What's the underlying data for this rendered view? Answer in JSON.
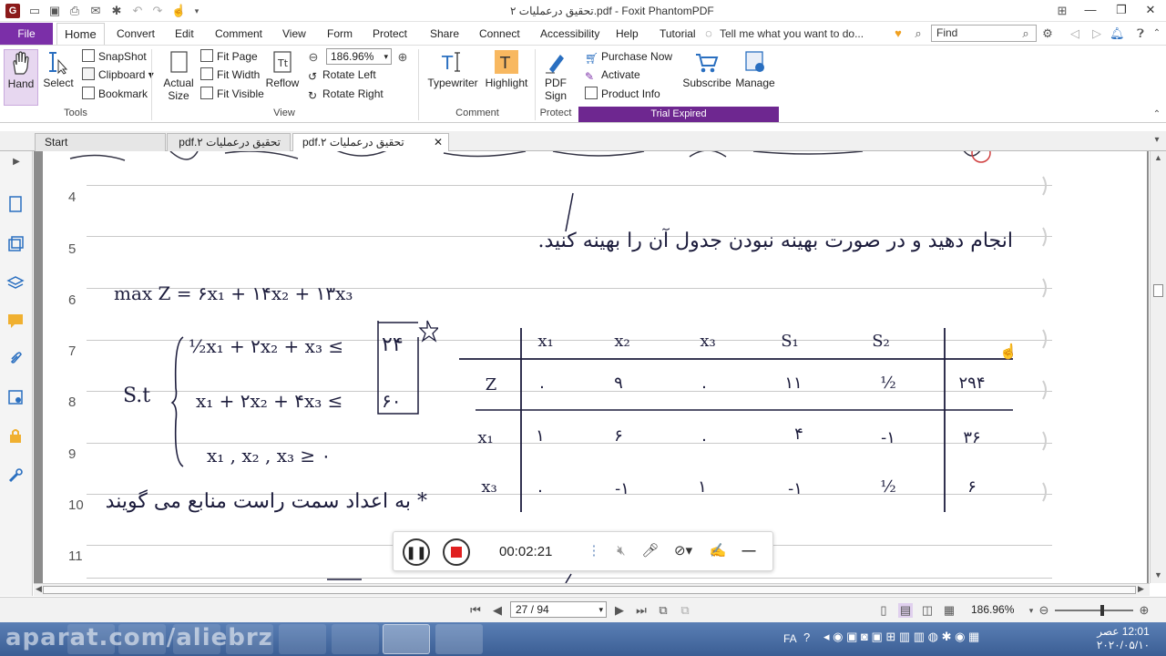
{
  "window": {
    "title": "تحقیق درعملیات ۲.pdf - Foxit PhantomPDF",
    "minimize": "—",
    "restore": "❐",
    "close": "✕"
  },
  "menu": {
    "file": "File",
    "items": [
      "Home",
      "Convert",
      "Edit",
      "Comment",
      "View",
      "Form",
      "Protect",
      "Share",
      "Connect",
      "Accessibility",
      "Help",
      "Tutorial"
    ],
    "tell_me": "Tell me what you want to do...",
    "find_placeholder": "Find"
  },
  "ribbon": {
    "tools": {
      "hand": "Hand",
      "select": "Select",
      "snapshot": "SnapShot",
      "clipboard": "Clipboard",
      "bookmark": "Bookmark",
      "label": "Tools"
    },
    "view": {
      "actual_size_1": "Actual",
      "actual_size_2": "Size",
      "fit_page": "Fit Page",
      "fit_width": "Fit Width",
      "fit_visible": "Fit Visible",
      "reflow": "Reflow",
      "zoom": "186.96%",
      "rotate_left": "Rotate Left",
      "rotate_right": "Rotate Right",
      "label": "View"
    },
    "comment": {
      "typewriter": "Typewriter",
      "highlight": "Highlight",
      "label": "Comment"
    },
    "protect": {
      "pdf_sign_1": "PDF",
      "pdf_sign_2": "Sign",
      "label": "Protect"
    },
    "trial": {
      "purchase": "Purchase Now",
      "activate": "Activate",
      "product_info": "Product Info",
      "subscribe": "Subscribe",
      "manage": "Manage",
      "label": "Trial Expired"
    }
  },
  "tabs": {
    "start": "Start",
    "tab1": "تحقیق درعملیات ۲.pdf",
    "tab2": "تحقیق درعملیات ۲.pdf",
    "close": "✕"
  },
  "document": {
    "line_numbers": [
      "4",
      "5",
      "6",
      "7",
      "8",
      "9",
      "10",
      "11"
    ],
    "instruction": "انجام دهید و در صورت بهینه نبودن جدول آن را بهینه کنید.",
    "objective": "max Z = ۶x₁ + ۱۴x₂ + ۱۳x₃",
    "st": "S.t",
    "constraint1": "½x₁ + ۲x₂ + x₃ ≤",
    "constraint1_rhs": "۲۴",
    "constraint2": "x₁ + ۲x₂ + ۴x₃ ≤",
    "constraint2_rhs": "۶۰",
    "nonneg": "x₁ , x₂ , x₃ ≥ ۰",
    "note": "* به اعداد سمت راست منابع می گویند",
    "table": {
      "headers": [
        "x₁",
        "x₂",
        "x₃",
        "S₁",
        "S₂"
      ],
      "rows": [
        {
          "basis": "Z",
          "values": [
            "۰",
            "۹",
            "۰",
            "۱۱",
            "½"
          ],
          "rhs": "۲۹۴"
        },
        {
          "basis": "x₁",
          "values": [
            "۱",
            "۶",
            "۰",
            "۴",
            "-۱"
          ],
          "rhs": "۳۶"
        },
        {
          "basis": "x₃",
          "values": [
            "۰",
            "-۱",
            "۱",
            "-۱",
            "½"
          ],
          "rhs": "۶"
        }
      ]
    }
  },
  "recorder": {
    "time": "00:02:21"
  },
  "status": {
    "page": "27 / 94",
    "zoom": "186.96%"
  },
  "taskbar": {
    "watermark": "aparat.com/aliebrz",
    "lang": "FA",
    "clock_time": "12:01 عصر",
    "clock_date": "۲۰۲۰/۰۵/۱۰"
  }
}
